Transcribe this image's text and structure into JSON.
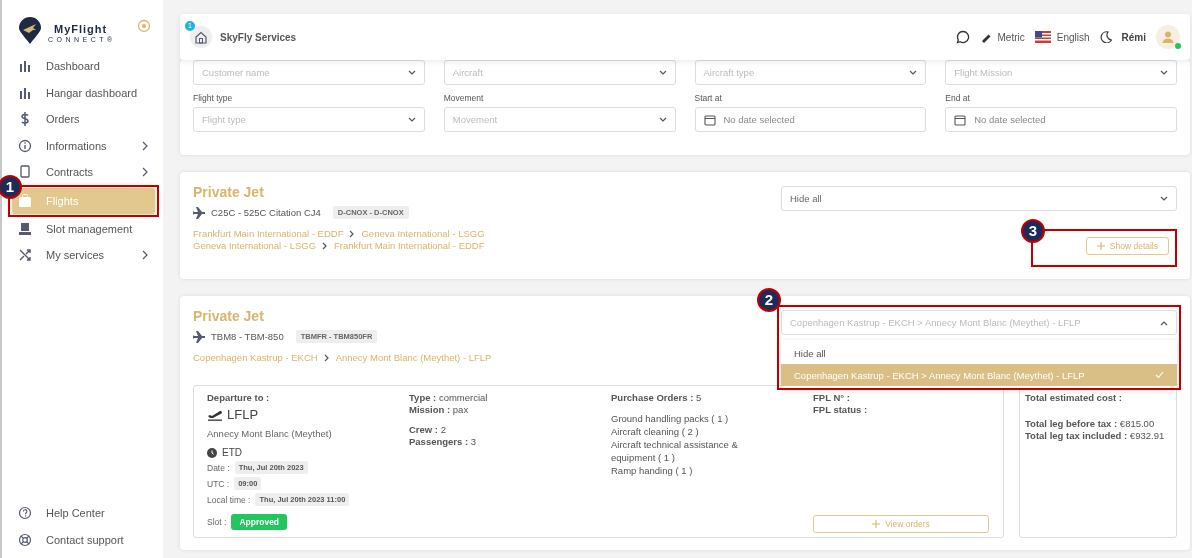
{
  "sidebar": {
    "logo": {
      "name": "MyFlight",
      "tagline": "CONNECT®"
    },
    "items": [
      {
        "label": "Dashboard",
        "expandable": false,
        "selected": false
      },
      {
        "label": "Hangar dashboard",
        "expandable": false,
        "selected": false
      },
      {
        "label": "Orders",
        "expandable": false,
        "selected": false
      },
      {
        "label": "Informations",
        "expandable": true,
        "selected": false
      },
      {
        "label": "Contracts",
        "expandable": true,
        "selected": false
      },
      {
        "label": "Flights",
        "expandable": false,
        "selected": true
      },
      {
        "label": "Slot management",
        "expandable": false,
        "selected": false
      },
      {
        "label": "My services",
        "expandable": true,
        "selected": false
      }
    ],
    "footer_items": [
      {
        "label": "Help Center"
      },
      {
        "label": "Contact support"
      }
    ]
  },
  "header": {
    "organization": "SkyFly Services",
    "notification_count": "1",
    "units": "Metric",
    "language": "English",
    "user": "Rémi",
    "user_online": true
  },
  "filters": [
    {
      "placeholder": "Customer name",
      "kind": "select"
    },
    {
      "placeholder": "Aircraft",
      "kind": "select"
    },
    {
      "placeholder": "Aircraft type",
      "kind": "select"
    },
    {
      "placeholder": "Flight Mission",
      "kind": "select"
    },
    {
      "label": "Flight type",
      "placeholder": "Flight type",
      "kind": "select"
    },
    {
      "label": "Movement",
      "placeholder": "Movement",
      "kind": "select"
    },
    {
      "label": "Start at",
      "placeholder": "No date selected",
      "kind": "date"
    },
    {
      "label": "End at",
      "placeholder": "No date selected",
      "kind": "date"
    }
  ],
  "flights": [
    {
      "category": "Private Jet",
      "aircraft": "C25C - 525C Citation CJ4",
      "registration": "D-CNOX - D-CNOX",
      "legs": [
        {
          "from": "Frankfurt Main International - EDDF",
          "to": "Geneva International - LSGG"
        },
        {
          "from": "Geneva International - LSGG",
          "to": "Frankfurt Main International - EDDF"
        }
      ],
      "leg_select": {
        "value": "Hide all",
        "expanded": false
      },
      "show_details": "Show details"
    },
    {
      "category": "Private Jet",
      "aircraft": "TBM8 - TBM-850",
      "registration": "TBMFR - TBM850FR",
      "legs": [
        {
          "from": "Copenhagen Kastrup - EKCH",
          "to": "Annecy Mont Blanc (Meythet) - LFLP"
        }
      ],
      "leg_select": {
        "placeholder": "Copenhagen Kastrup - EKCH > Annecy Mont Blanc (Meythet) - LFLP",
        "expanded": true,
        "options": [
          {
            "label": "Hide all",
            "selected": false
          },
          {
            "label": "Copenhagen Kastrup - EKCH > Annecy Mont Blanc (Meythet) - LFLP",
            "selected": true
          }
        ]
      },
      "details": {
        "departure_label": "Departure to :",
        "airport_code": "LFLP",
        "airport_name": "Annecy Mont Blanc (Meythet)",
        "etd": "ETD",
        "times": [
          {
            "label": "Date :",
            "value": "Thu, Jul 20th 2023"
          },
          {
            "label": "UTC :",
            "value": "09:00"
          },
          {
            "label": "Local time :",
            "value": "Thu, Jul 20th 2023 11:00"
          }
        ],
        "slot_label": "Slot :",
        "slot_status": "Approved",
        "info_groups": [
          [
            {
              "label": "Type :",
              "value": "commercial"
            },
            {
              "label": "Mission :",
              "value": "pax"
            }
          ],
          [
            {
              "label": "Crew :",
              "value": "2"
            },
            {
              "label": "Passengers :",
              "value": "3"
            }
          ]
        ],
        "purchase_orders": {
          "label": "Purchase Orders :",
          "value": "5",
          "items": [
            "Ground handling packs ( 1 )",
            "Aircraft cleaning ( 2 )",
            "Aircraft technical assistance & equipment ( 1 )",
            "Ramp handing ( 1 )"
          ]
        },
        "fpl": [
          {
            "label": "FPL N° :"
          },
          {
            "label": "FPL status :"
          }
        ],
        "view_orders": "View orders",
        "costs": {
          "title": "Total estimated cost :",
          "lines": [
            {
              "label": "Total leg before tax :",
              "value": "€815.00"
            },
            {
              "label": "Total leg tax included :",
              "value": "€932.91"
            }
          ]
        }
      }
    }
  ],
  "annotations": [
    {
      "number": "1"
    },
    {
      "number": "2"
    },
    {
      "number": "3"
    }
  ]
}
